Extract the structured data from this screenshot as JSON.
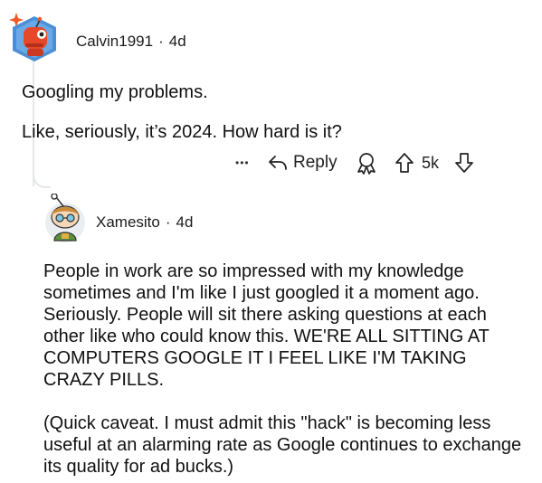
{
  "comments": [
    {
      "username": "Calvin1991",
      "separator": "·",
      "age": "4d",
      "paragraphs": [
        "Googling my problems.",
        "Like, seriously, it’s 2024. How hard is it?"
      ],
      "actions": {
        "more_label": "•••",
        "reply_label": "Reply",
        "score": "5k"
      }
    },
    {
      "username": "Xamesito",
      "separator": "·",
      "age": "4d",
      "paragraphs": [
        "People in work are so impressed with my knowledge sometimes and I'm like I just googled it a moment ago. Seriously. People will sit there asking questions at each other like who could know this. WE'RE ALL SITTING AT COMPUTERS GOOGLE IT I FEEL LIKE I'M TAKING CRAZY PILLS.",
        "(Quick caveat. I must admit this \"hack\" is becoming less useful at an alarming rate as Google continues to exchange its quality for ad bucks.)"
      ]
    }
  ],
  "colors": {
    "thread_line": "#e4e6e8",
    "avatar1_bg": "#4a8fd6",
    "avatar1_robot": "#e8482a",
    "avatar2_bg": "#eaeef1"
  },
  "icons": {
    "more": "more-dots-icon",
    "reply": "reply-arrow-icon",
    "award": "award-icon",
    "upvote": "upvote-arrow-icon",
    "downvote": "downvote-arrow-icon"
  }
}
